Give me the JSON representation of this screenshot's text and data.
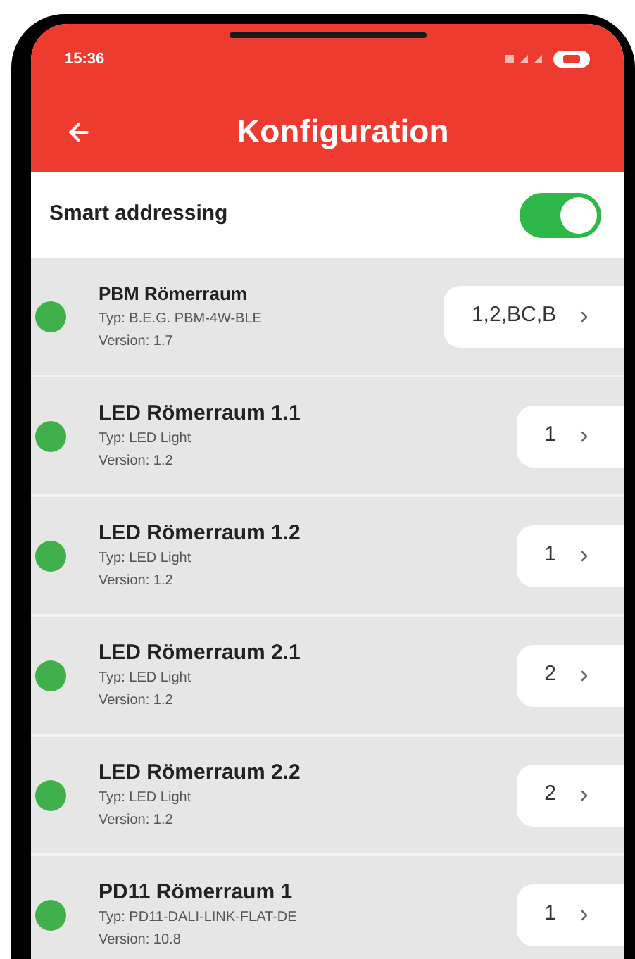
{
  "status_bar": {
    "time": "15:36"
  },
  "header": {
    "title": "Konfiguration"
  },
  "smart_addressing": {
    "label": "Smart addressing",
    "on": true
  },
  "devices": [
    {
      "name": "PBM Römerraum",
      "type": "Typ: B.E.G. PBM-4W-BLE",
      "version": "Version: 1.7",
      "address": "1,2,BC,B",
      "color": "#3fb04a"
    },
    {
      "name": "LED Römerraum 1.1",
      "type": "Typ: LED Light",
      "version": "Version: 1.2",
      "address": "1",
      "color": "#3fb04a"
    },
    {
      "name": "LED Römerraum 1.2",
      "type": "Typ: LED Light",
      "version": "Version: 1.2",
      "address": "1",
      "color": "#3fb04a"
    },
    {
      "name": "LED Römerraum 2.1",
      "type": "Typ: LED Light",
      "version": "Version: 1.2",
      "address": "2",
      "color": "#3fb04a"
    },
    {
      "name": "LED Römerraum 2.2",
      "type": "Typ: LED Light",
      "version": "Version: 1.2",
      "address": "2",
      "color": "#3fb04a"
    },
    {
      "name": "PD11 Römerraum 1",
      "type": "Typ: PD11-DALI-LINK-FLAT-DE",
      "version": "Version: 10.8",
      "address": "1",
      "color": "#3fb04a"
    }
  ]
}
